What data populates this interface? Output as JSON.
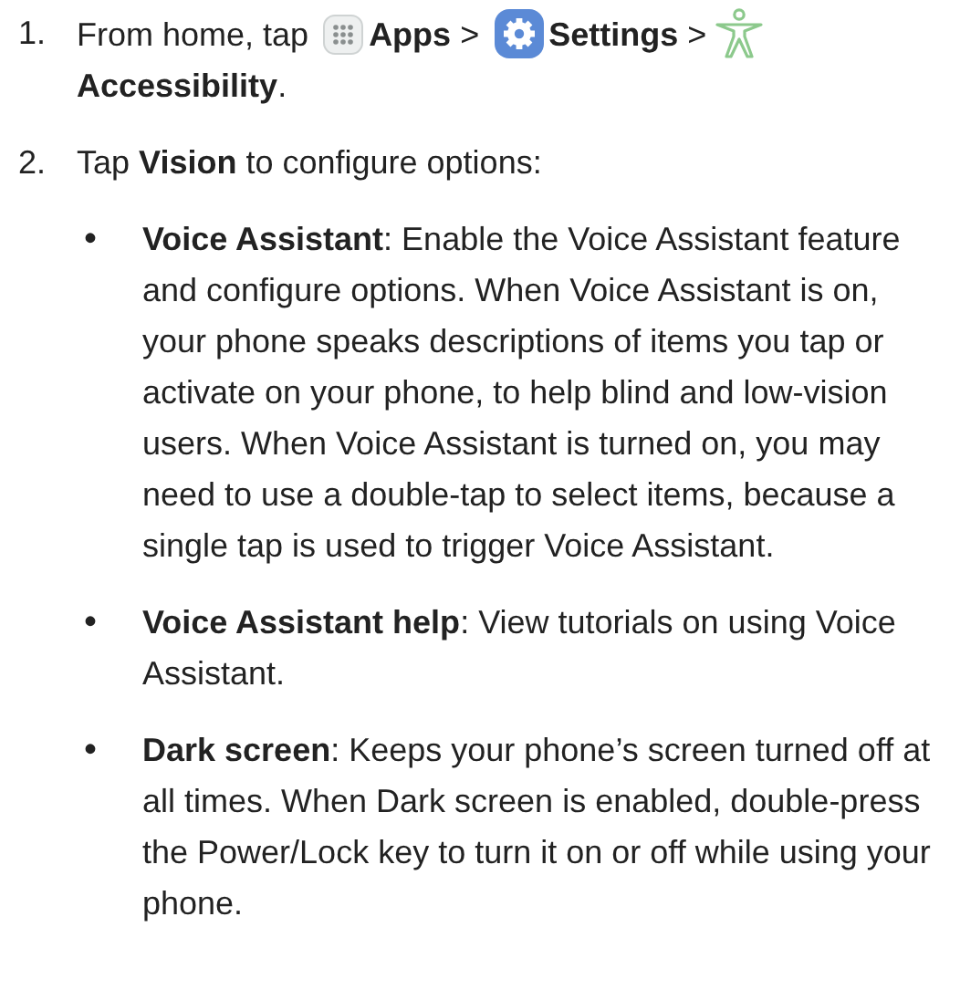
{
  "steps": [
    {
      "number": "1.",
      "parts": [
        {
          "kind": "text",
          "text": "From home, tap"
        },
        {
          "kind": "apps"
        },
        {
          "kind": "text",
          "text": "**Apps** >"
        },
        {
          "kind": "gear"
        },
        {
          "kind": "text",
          "text": "**Settings** >"
        },
        {
          "kind": "person"
        },
        {
          "kind": "text",
          "text": "**Accessibility**."
        }
      ]
    },
    {
      "number": "2.",
      "parts": [
        {
          "kind": "text",
          "text": "Tap **Vision** to configure options:"
        }
      ],
      "bullets": [
        {
          "bullet": "•",
          "text": "**Voice Assistant**: Enable the Voice Assistant feature and configure options. When Voice Assistant is on, your phone speaks descriptions of items you tap or activate on your phone, to help blind and low-vision users. When Voice Assistant is turned on, you may need to use a double-tap to select items, because a single tap is used to trigger Voice Assistant."
        },
        {
          "bullet": "•",
          "text": "**Voice Assistant help**: View tutorials on using Voice Assistant."
        },
        {
          "bullet": "•",
          "text": "**Dark screen**: Keeps your phone’s screen turned off at all times. When Dark screen is enabled, double-press the Power/Lock key to turn it on or off while using your phone."
        }
      ]
    }
  ]
}
